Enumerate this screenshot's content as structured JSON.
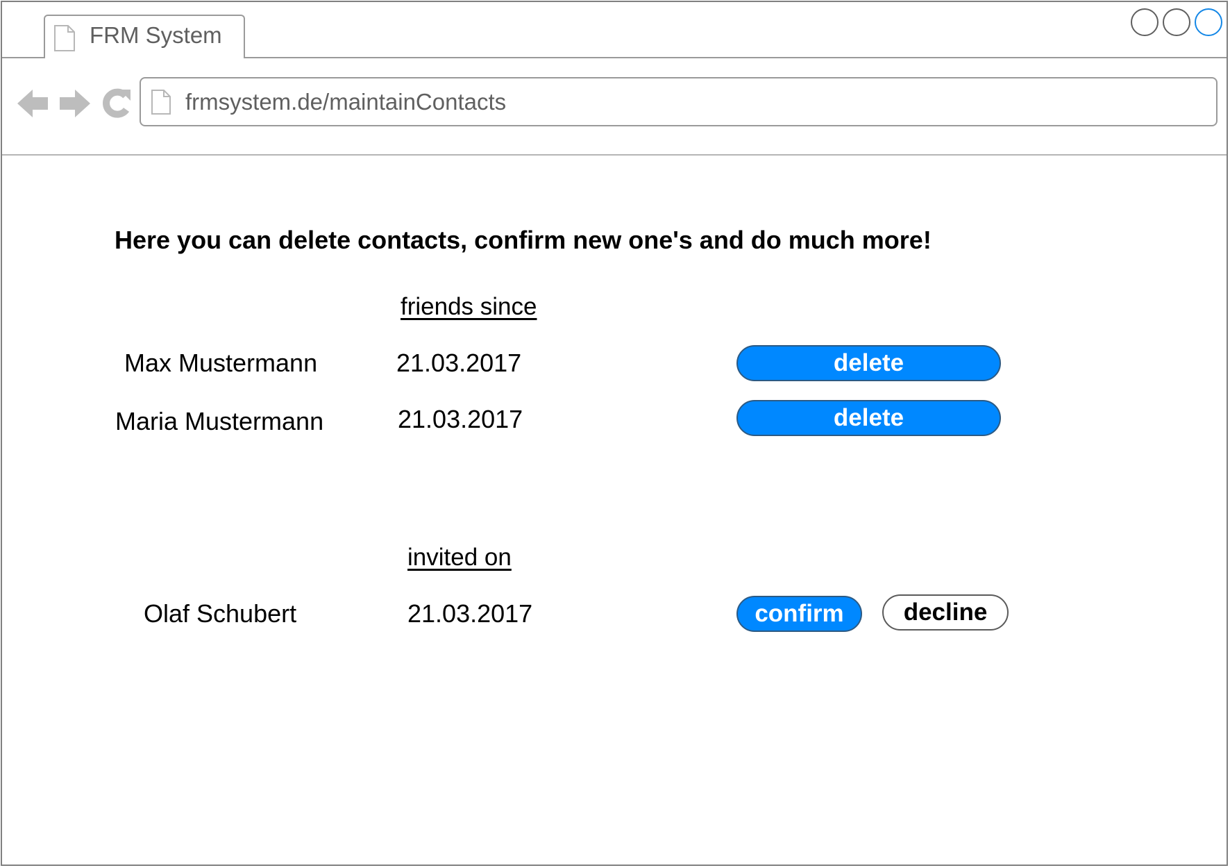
{
  "browser": {
    "tab_title": "FRM System",
    "address": "frmsystem.de/maintainContacts"
  },
  "page": {
    "intro": "Here you can delete contacts, confirm new one's and do much more!"
  },
  "friends": {
    "header": "friends since",
    "rows": [
      {
        "name": "Max Mustermann",
        "date": "21.03.2017",
        "action": "delete"
      },
      {
        "name": "Maria Mustermann",
        "date": "21.03.2017",
        "action": "delete"
      }
    ]
  },
  "invitations": {
    "header": "invited on",
    "rows": [
      {
        "name": "Olaf Schubert",
        "date": "21.03.2017",
        "confirm": "confirm",
        "decline": "decline"
      }
    ]
  },
  "colors": {
    "primary_button": "#0088ff",
    "button_text": "#ffffff"
  },
  "icons": {
    "tab": "page-icon",
    "back": "back-arrow-icon",
    "forward": "forward-arrow-icon",
    "reload": "reload-icon",
    "address": "page-icon"
  }
}
